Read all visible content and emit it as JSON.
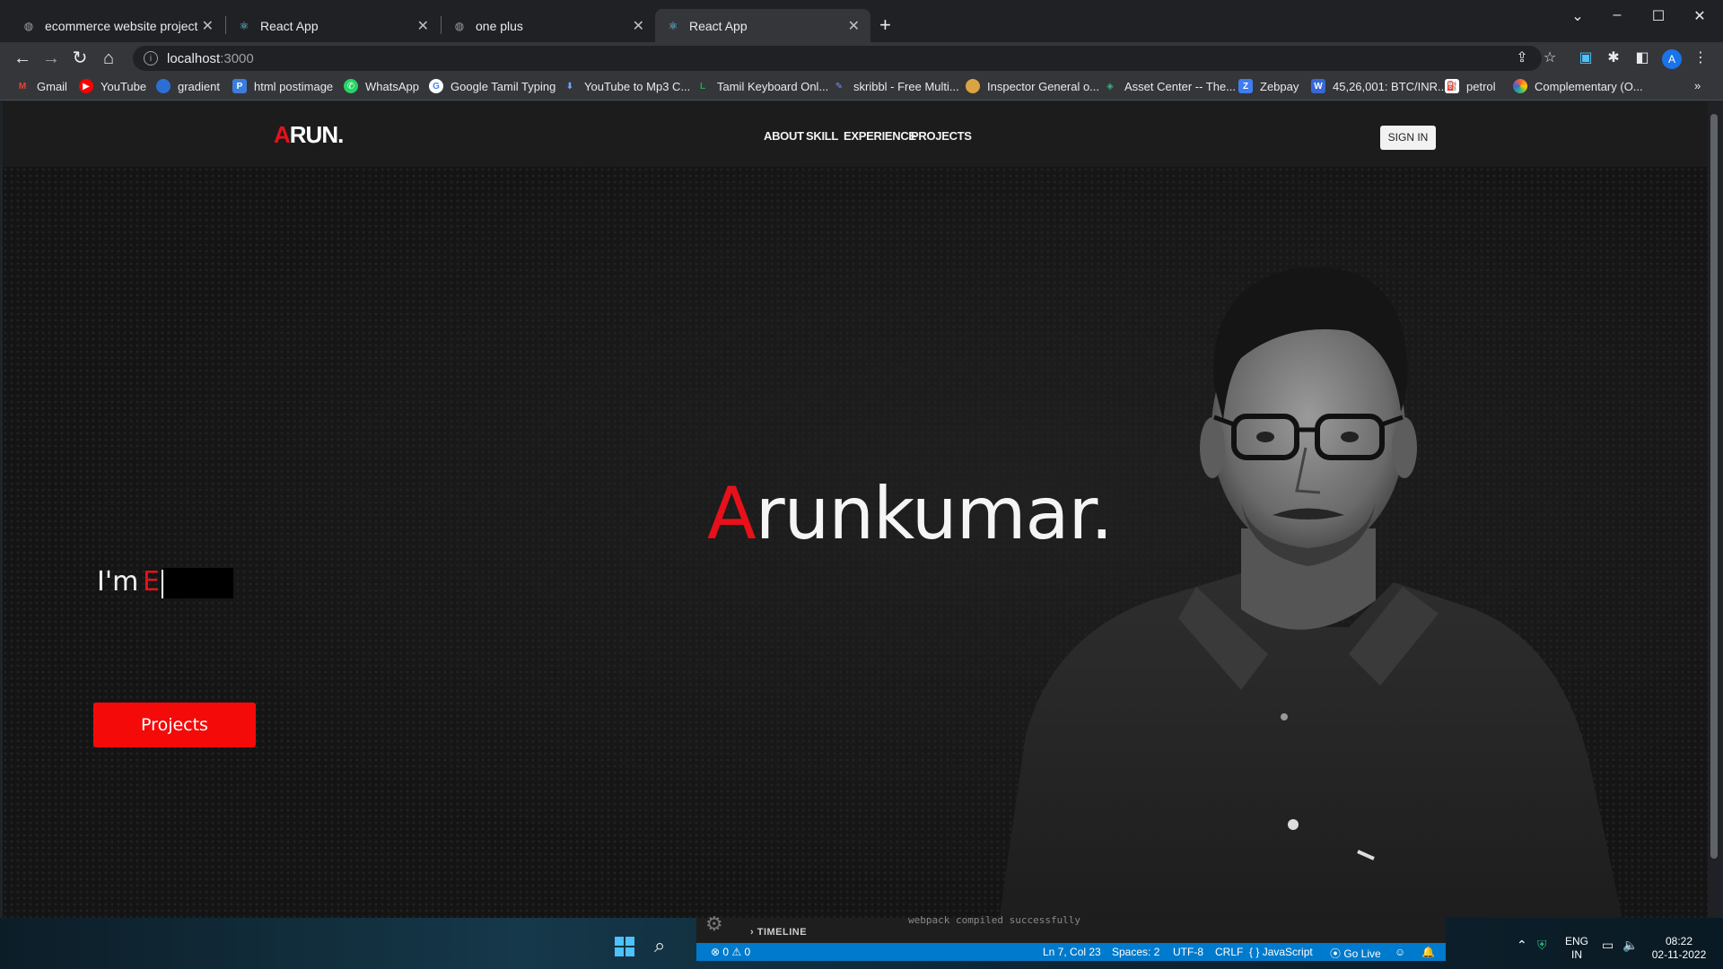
{
  "browser": {
    "tabs": [
      {
        "title": "ecommerce website project",
        "active": false
      },
      {
        "title": "React App",
        "active": false
      },
      {
        "title": "one plus",
        "active": false
      },
      {
        "title": "React App",
        "active": true
      }
    ],
    "new_tab": "+",
    "url_host": "localhost",
    "url_port": ":3000",
    "bookmarks": [
      {
        "label": "Gmail",
        "icon": "gmail-icon",
        "color": "#ea4335"
      },
      {
        "label": "YouTube",
        "icon": "youtube-icon",
        "color": "#ff0000"
      },
      {
        "label": "gradient",
        "icon": "gradient-icon",
        "color": "#2b6fd6"
      },
      {
        "label": "html postimage",
        "icon": "postimage-icon",
        "color": "#3b7ddd"
      },
      {
        "label": "WhatsApp",
        "icon": "whatsapp-icon",
        "color": "#25d366"
      },
      {
        "label": "Google Tamil Typing",
        "icon": "google-icon",
        "color": "#ffffff"
      },
      {
        "label": "YouTube to Mp3 C...",
        "icon": "download-icon",
        "color": "#6aa9ff"
      },
      {
        "label": "Tamil Keyboard Onl...",
        "icon": "keyboard-icon",
        "color": "#22aa44"
      },
      {
        "label": "skribbl - Free Multi...",
        "icon": "pencil-icon",
        "color": "#7b8cff"
      },
      {
        "label": "Inspector General o...",
        "icon": "emblem-icon",
        "color": "#d9a441"
      },
      {
        "label": "Asset Center -- The...",
        "icon": "asset-icon",
        "color": "#2fb67c"
      },
      {
        "label": "Zebpay",
        "icon": "zebpay-icon",
        "color": "#3f7cf2"
      },
      {
        "label": "45,26,001: BTC/INR...",
        "icon": "wazirx-icon",
        "color": "#3867d6"
      },
      {
        "label": "petrol",
        "icon": "petrol-icon",
        "color": "#ffffff"
      },
      {
        "label": "Complementary (O...",
        "icon": "colorwheel-icon",
        "color": "#ff5a36"
      }
    ],
    "more_bookmarks": "»"
  },
  "site": {
    "logo_first": "A",
    "logo_rest": "RUN.",
    "nav": [
      "ABOUT",
      "SKILL",
      "EXPERIENCE",
      "PROJECTS"
    ],
    "signin": "SIGN IN",
    "hero_first": "A",
    "hero_rest": "runkumar.",
    "im": "I'm",
    "typed": "E(",
    "projects_button": "Projects",
    "accent": "#e8101a"
  },
  "vscode": {
    "section": "TIMELINE",
    "log": "webpack compiled successfully",
    "errors": "0",
    "warnings": "0",
    "position": "Ln 7, Col 23",
    "spaces": "Spaces: 2",
    "encoding": "UTF-8",
    "eol": "CRLF",
    "language": "JavaScript",
    "golive": "Go Live"
  },
  "taskbar": {
    "lang1": "ENG",
    "lang2": "IN",
    "time": "08:22",
    "date": "02-11-2022"
  }
}
